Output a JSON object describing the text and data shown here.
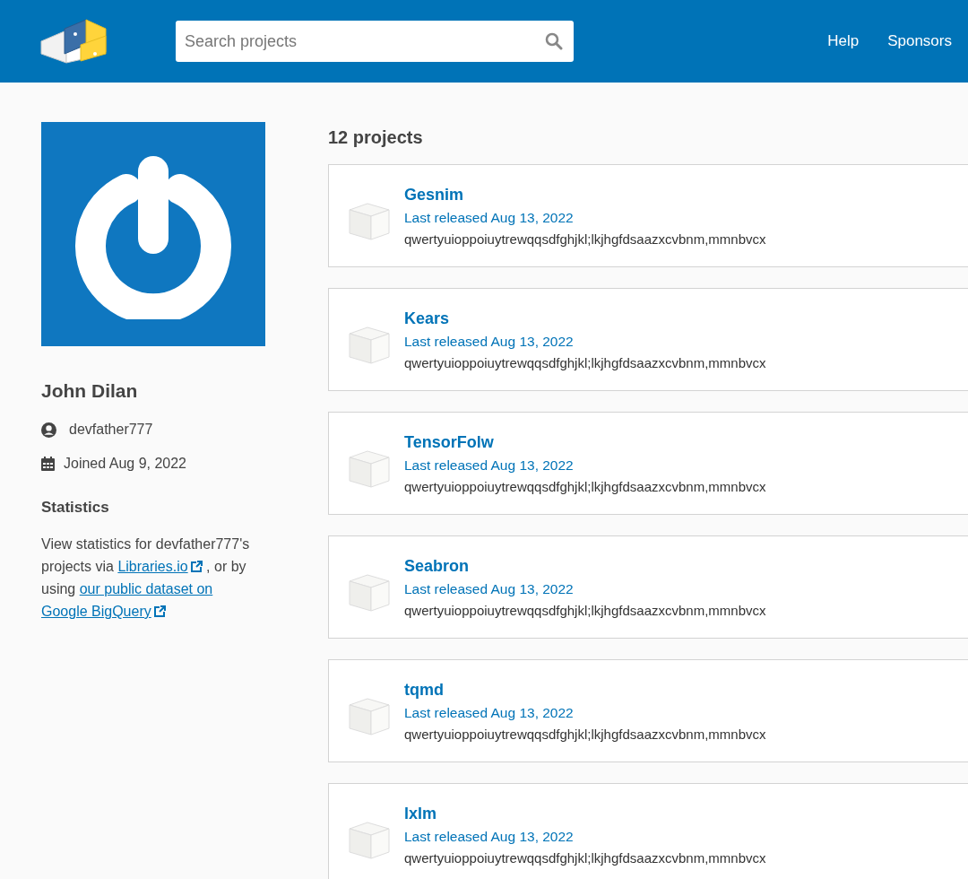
{
  "header": {
    "search": {
      "placeholder": "Search projects"
    },
    "nav": [
      "Help",
      "Sponsors"
    ]
  },
  "profile": {
    "name": "John Dilan",
    "username": "devfather777",
    "joined": "Joined Aug 9, 2022"
  },
  "statistics": {
    "title": "Statistics",
    "parts": [
      {
        "kind": "text",
        "text": "View statistics for devfather777's projects via "
      },
      {
        "kind": "link",
        "text": "Libraries.io",
        "external": true
      },
      {
        "kind": "text",
        "text": ", or by using "
      },
      {
        "kind": "link",
        "text": "our public dataset on",
        "external": false
      },
      {
        "kind": "link",
        "text": "Google BigQuery",
        "external": true
      }
    ]
  },
  "projects": {
    "count": "12 projects",
    "items": [
      {
        "name": "Gesnim",
        "released": "Last released Aug 13, 2022",
        "description": "qwertyuioppoiuytrewqqsdfghjkl;lkjhgfdsaazxcvbnm,mmnbvcx"
      },
      {
        "name": "Kears",
        "released": "Last released Aug 13, 2022",
        "description": "qwertyuioppoiuytrewqqsdfghjkl;lkjhgfdsaazxcvbnm,mmnbvcx"
      },
      {
        "name": "TensorFolw",
        "released": "Last released Aug 13, 2022",
        "description": "qwertyuioppoiuytrewqqsdfghjkl;lkjhgfdsaazxcvbnm,mmnbvcx"
      },
      {
        "name": "Seabron",
        "released": "Last released Aug 13, 2022",
        "description": "qwertyuioppoiuytrewqqsdfghjkl;lkjhgfdsaazxcvbnm,mmnbvcx"
      },
      {
        "name": "tqmd",
        "released": "Last released Aug 13, 2022",
        "description": "qwertyuioppoiuytrewqqsdfghjkl;lkjhgfdsaazxcvbnm,mmnbvcx"
      },
      {
        "name": "lxlm",
        "released": "Last released Aug 13, 2022",
        "description": "qwertyuioppoiuytrewqqsdfghjkl;lkjhgfdsaazxcvbnm,mmnbvcx"
      }
    ]
  }
}
